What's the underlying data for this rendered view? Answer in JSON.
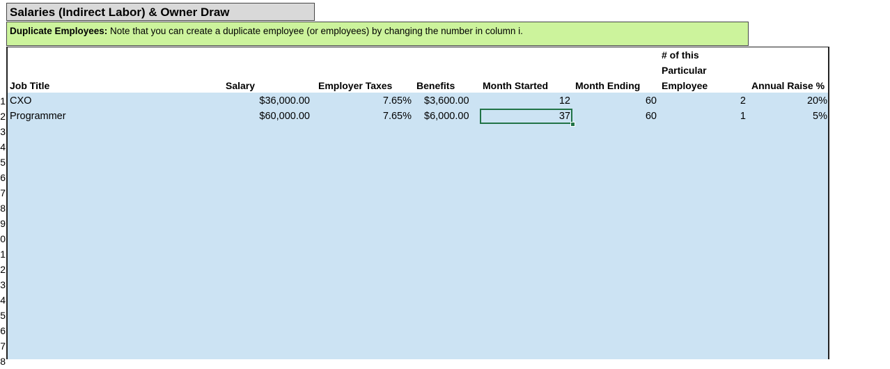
{
  "title": "Salaries (Indirect Labor) & Owner Draw",
  "note": {
    "bold": "Duplicate Employees:",
    "text": " Note that you can create a duplicate employee (or employees) by changing the number in column i."
  },
  "headers": {
    "job_title": "Job Title",
    "salary": "Salary",
    "employer_taxes": "Employer Taxes",
    "benefits": "Benefits",
    "month_started": "Month Started",
    "month_ending": "Month Ending",
    "num_employee_line1": "# of this",
    "num_employee_line2": "Particular",
    "num_employee_line3": "Employee",
    "annual_raise": "Annual Raise %"
  },
  "rows": [
    {
      "num": "1",
      "job_title": "CXO",
      "salary": "$36,000.00",
      "taxes": "7.65%",
      "benefits": "$3,600.00",
      "month_started": "12",
      "month_ending": "60",
      "count": "2",
      "raise": "20%"
    },
    {
      "num": "2",
      "job_title": "Programmer",
      "salary": "$60,000.00",
      "taxes": "7.65%",
      "benefits": "$6,000.00",
      "month_started": "37",
      "month_ending": "60",
      "count": "1",
      "raise": "5%"
    }
  ],
  "row_numbers": [
    "1",
    "2",
    "3",
    "4",
    "5",
    "6",
    "7",
    "8",
    "9",
    "0",
    "1",
    "2",
    "3",
    "4",
    "5",
    "6",
    "7",
    "8"
  ]
}
